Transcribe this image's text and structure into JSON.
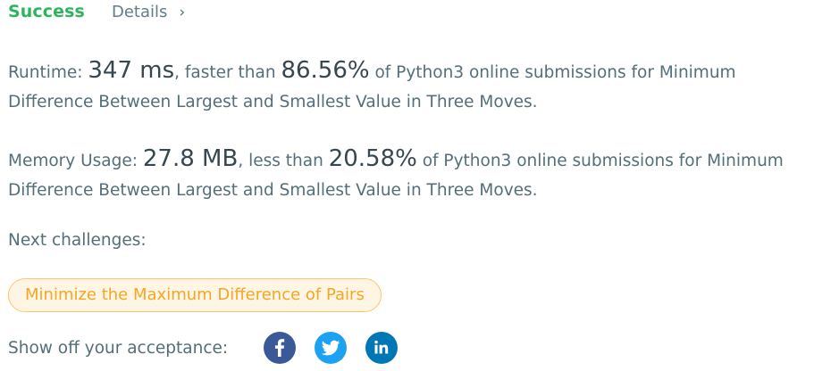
{
  "header": {
    "status": "Success",
    "details_label": "Details",
    "details_chevron": "›"
  },
  "runtime": {
    "label": "Runtime: ",
    "value": "347 ms",
    "comparison": ", faster than ",
    "percent": "86.56%",
    "suffix": " of Python3 online submissions for Minimum Difference Between Largest and Smallest Value in Three Moves."
  },
  "memory": {
    "label": "Memory Usage: ",
    "value": "27.8 MB",
    "comparison": ", less than ",
    "percent": "20.58%",
    "suffix": " of Python3 online submissions for Minimum Difference Between Largest and Smallest Value in Three Moves."
  },
  "next": {
    "label": "Next challenges:",
    "challenges": [
      "Minimize the Maximum Difference of Pairs"
    ]
  },
  "share": {
    "label": "Show off your acceptance:",
    "buttons": [
      {
        "icon": "facebook-icon",
        "color": "#3b5998"
      },
      {
        "icon": "twitter-icon",
        "color": "#1da1f2"
      },
      {
        "icon": "linkedin-icon",
        "color": "#0077b5"
      }
    ]
  },
  "colors": {
    "success": "#2db55d",
    "text": "#546e7a",
    "challenge_text": "#f5a623",
    "challenge_bg": "#fff5e4",
    "challenge_border": "#ffc56b"
  }
}
